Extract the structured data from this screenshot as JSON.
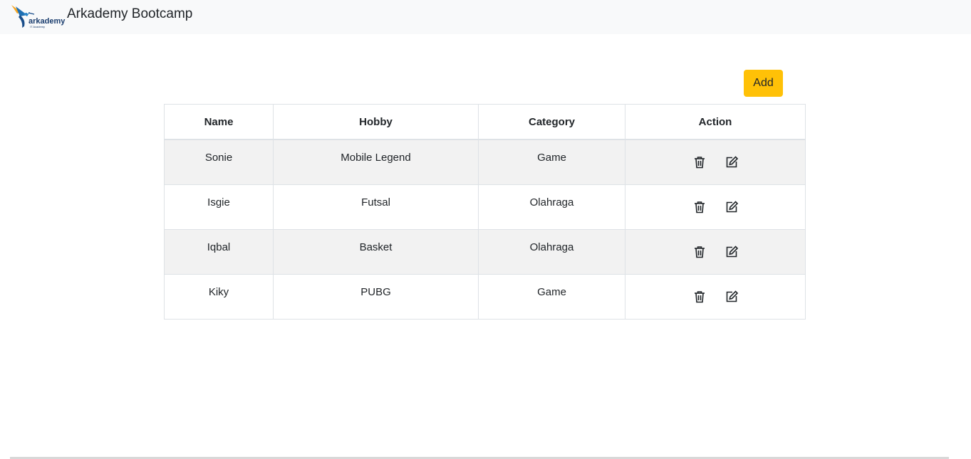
{
  "navbar": {
    "brand_title": "Arkademy Bootcamp",
    "logo_text": "arkademy",
    "logo_subtext": "IT Academy"
  },
  "toolbar": {
    "add_label": "Add"
  },
  "table": {
    "headers": [
      "Name",
      "Hobby",
      "Category",
      "Action"
    ],
    "rows": [
      {
        "name": "Sonie",
        "hobby": "Mobile Legend",
        "category": "Game"
      },
      {
        "name": "Isgie",
        "hobby": "Futsal",
        "category": "Olahraga"
      },
      {
        "name": "Iqbal",
        "hobby": "Basket",
        "category": "Olahraga"
      },
      {
        "name": "Kiky",
        "hobby": "PUBG",
        "category": "Game"
      }
    ],
    "actions": [
      {
        "icon": "trash-icon"
      },
      {
        "icon": "edit-icon"
      }
    ]
  },
  "colors": {
    "navbar_bg": "#f8f9fa",
    "add_button": "#ffc107",
    "stripe": "#f2f2f2",
    "border": "#dee2e6"
  }
}
